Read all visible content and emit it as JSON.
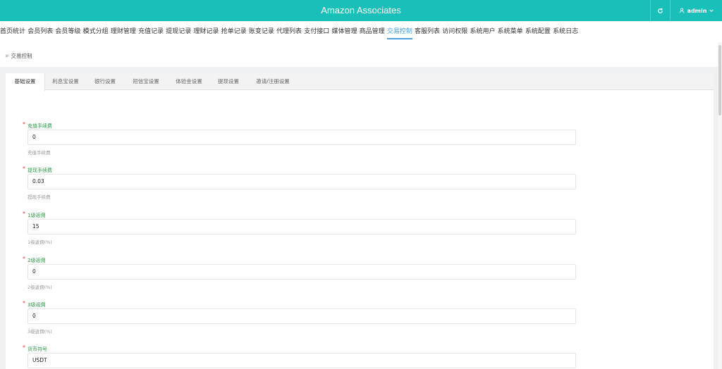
{
  "app": {
    "title": "Amazon Associates",
    "user": "admin"
  },
  "menu": [
    "首页统计",
    "会员列表",
    "会员等级",
    "模式分组",
    "理财管理",
    "充值记录",
    "提现记录",
    "理财记录",
    "抢单记录",
    "账变记录",
    "代理列表",
    "支付接口",
    "媒体管理",
    "商品管理",
    "交易控制",
    "客服列表",
    "访问权限",
    "系统用户",
    "系统菜单",
    "系统配置",
    "系统日志"
  ],
  "menu_active": "交易控制",
  "breadcrumb": "交易控制",
  "tabs": [
    "基础设置",
    "利息宝设置",
    "银行设置",
    "短信宝设置",
    "体验金设置",
    "提现设置",
    "邀请/注册设置"
  ],
  "fields": [
    {
      "label": "充值手续费",
      "value": "0",
      "hint": "充值手续费"
    },
    {
      "label": "提现手续费",
      "value": "0.03",
      "hint": "提现手续费"
    },
    {
      "label": "1级返佣",
      "value": "15",
      "hint": "1级返佣(%)"
    },
    {
      "label": "2级返佣",
      "value": "0",
      "hint": "2级返佣(%)"
    },
    {
      "label": "3级返佣",
      "value": "0",
      "hint": "3级返佣(%)"
    },
    {
      "label": "货币符号",
      "value": "USDT",
      "hint": ""
    }
  ],
  "colors": {
    "header": "#1abfb9",
    "active_menu": "#4a9fe0",
    "label": "#2a9b45",
    "required": "#e23b3b"
  }
}
